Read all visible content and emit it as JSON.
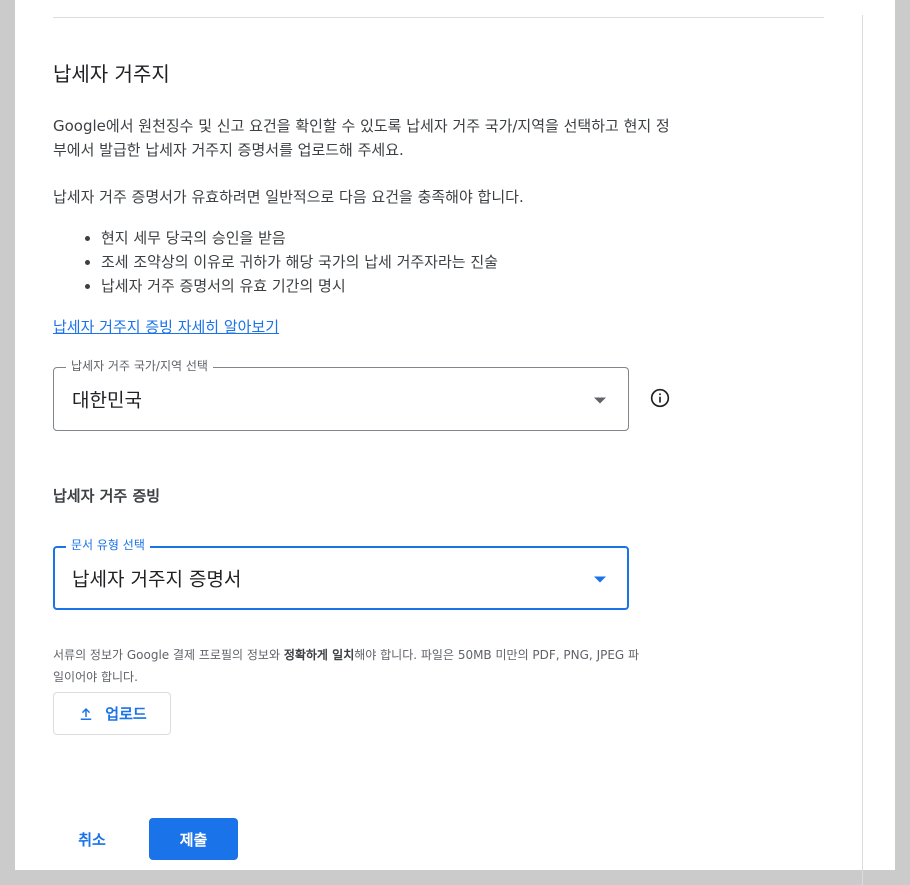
{
  "dialog": {
    "title": "납세자 거주지",
    "description": "Google에서 원천징수 및 신고 요건을 확인할 수 있도록 납세자 거주 국가/지역을 선택하고 현지 정부에서 발급한 납세자 거주지 증명서를 업로드해 주세요.",
    "requirements_intro": "납세자 거주 증명서가 유효하려면 일반적으로 다음 요건을 충족해야 합니다.",
    "requirements": [
      "현지 세무 당국의 승인을 받음",
      "조세 조약상의 이유로 귀하가 해당 국가의 납세 거주자라는 진술",
      "납세자 거주 증명서의 유효 기간의 명시"
    ],
    "learn_more_link": "납세자 거주지 증빙 자세히 알아보기",
    "country_select": {
      "label": "납세자 거주 국가/지역 선택",
      "value": "대한민국"
    },
    "proof_section_title": "납세자 거주 증빙",
    "document_select": {
      "label": "문서 유형 선택",
      "value": "납세자 거주지 증명서"
    },
    "note": {
      "part1": "서류의 정보가 Google 결제 프로필의 정보와 ",
      "bold": "정확하게 일치",
      "part2": "해야 합니다. 파일은 50MB 미만의 PDF, PNG, JPEG 파일이어야 합니다."
    },
    "upload_button": "업로드",
    "cancel_button": "취소",
    "submit_button": "제출"
  },
  "icons": {
    "info": "info-icon",
    "upload": "upload-icon",
    "dropdown": "chevron-down-icon"
  },
  "colors": {
    "accent": "#1a73e8",
    "text": "#3c4043",
    "background": "#ffffff",
    "outer": "#cbcbcb"
  }
}
